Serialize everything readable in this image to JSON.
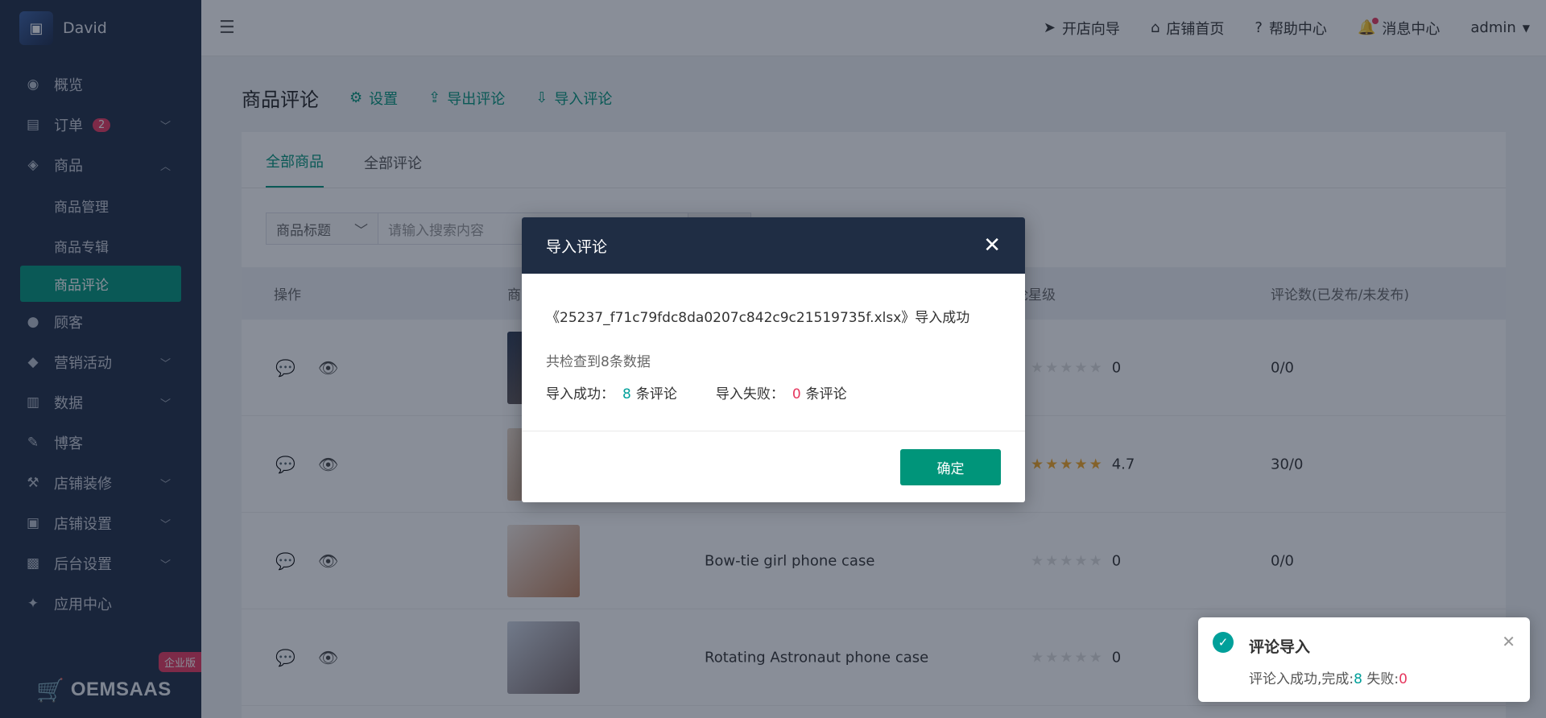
{
  "sidebar": {
    "user_name": "David",
    "menu": [
      {
        "label": "概览",
        "icon": "dashboard-icon"
      },
      {
        "label": "订单",
        "icon": "order-icon",
        "badge": "2"
      },
      {
        "label": "商品",
        "icon": "product-icon"
      },
      {
        "label": "顾客",
        "icon": "customer-icon"
      },
      {
        "label": "营销活动",
        "icon": "tag-icon"
      },
      {
        "label": "数据",
        "icon": "chart-icon"
      },
      {
        "label": "博客",
        "icon": "blog-icon"
      },
      {
        "label": "店铺装修",
        "icon": "brush-icon"
      },
      {
        "label": "店铺设置",
        "icon": "store-icon"
      },
      {
        "label": "后台设置",
        "icon": "settings-icon"
      },
      {
        "label": "应用中心",
        "icon": "wrench-icon"
      }
    ],
    "submenu": [
      "商品管理",
      "商品专辑",
      "商品评论"
    ],
    "logo_text": "OEMSAAS",
    "edition": "企业版"
  },
  "header": {
    "nav": [
      "开店向导",
      "店铺首页",
      "帮助中心",
      "消息中心"
    ],
    "user": "admin"
  },
  "page": {
    "title": "商品评论",
    "actions": [
      "设置",
      "导出评论",
      "导入评论"
    ],
    "tabs": [
      "全部商品",
      "全部评论"
    ],
    "search_select": "商品标题",
    "search_placeholder": "请输入搜索内容"
  },
  "table": {
    "headers": [
      "操作",
      "商",
      "论星级",
      "评论数(已发布/未发布)"
    ],
    "rows": [
      {
        "name": "",
        "rating": "0",
        "stars": 0,
        "count": "0/0"
      },
      {
        "name": "",
        "rating": "4.7",
        "stars": 4.7,
        "count": "30/0"
      },
      {
        "name": "Bow-tie girl phone case",
        "rating": "0",
        "stars": 0,
        "count": "0/0"
      },
      {
        "name": "Rotating Astronaut phone case",
        "rating": "0",
        "stars": 0,
        "count": ""
      }
    ]
  },
  "modal": {
    "title": "导入评论",
    "file_message": "《25237_f71c79fdc8da0207c842c9c21519735f.xlsx》导入成功",
    "count_message": "共检查到8条数据",
    "success_label": "导入成功：",
    "success_value": "8",
    "success_unit": "条评论",
    "fail_label": "导入失败：",
    "fail_value": "0",
    "fail_unit": "条评论",
    "confirm": "确定"
  },
  "toast": {
    "title": "评论导入",
    "msg_prefix": "评论入成功,完成:",
    "done": "8",
    "fail_prefix": " 失败:",
    "fail": "0"
  },
  "colors": {
    "accent": "#00957a",
    "sidebar": "#1f2d44",
    "danger": "#e6375e"
  }
}
